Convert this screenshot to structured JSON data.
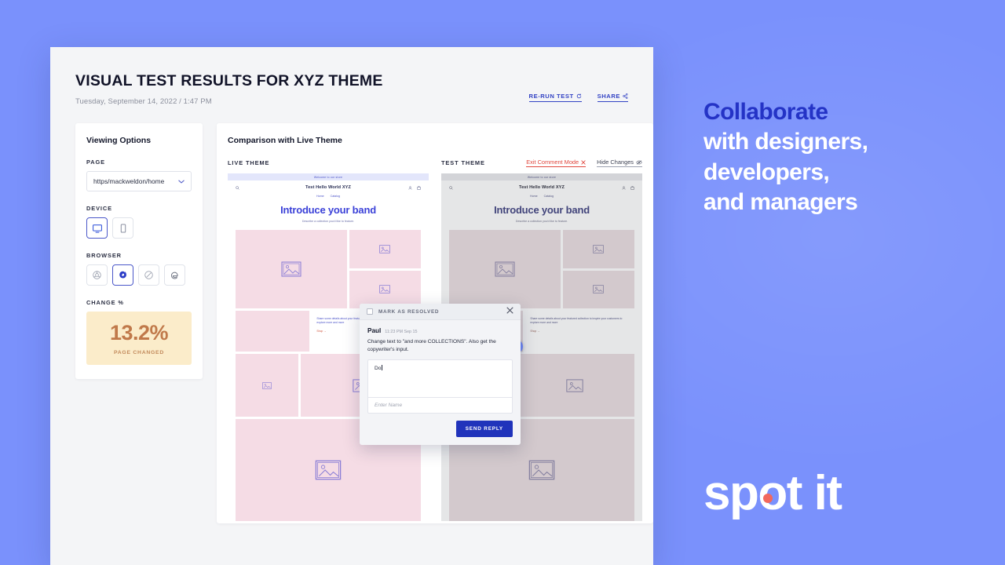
{
  "brand": {
    "headline_1": "Collaborate",
    "headline_2": "with designers,",
    "headline_3": "developers,",
    "headline_4": "and managers",
    "logo_text": "spot it",
    "accent_blue": "#7a91fc",
    "accent_navy": "#2433c6",
    "accent_coral": "#f2685e"
  },
  "app": {
    "title": "VISUAL TEST RESULTS FOR XYZ THEME",
    "date": "Tuesday, September 14, 2022 / 1:47 PM",
    "actions": [
      {
        "label": "RE-RUN TEST",
        "icon": "refresh-icon"
      },
      {
        "label": "SHARE",
        "icon": "share-icon"
      }
    ]
  },
  "sidebar": {
    "title": "Viewing Options",
    "page": {
      "label": "PAGE",
      "value": "https/mackweldon/home"
    },
    "device": {
      "label": "DEVICE",
      "options": [
        {
          "name": "desktop",
          "icon": "monitor-icon",
          "selected": true
        },
        {
          "name": "mobile",
          "icon": "phone-icon",
          "selected": false
        }
      ]
    },
    "browser": {
      "label": "BROWSER",
      "options": [
        {
          "name": "chrome",
          "icon": "chrome-icon",
          "selected": false
        },
        {
          "name": "firefox",
          "icon": "firefox-icon",
          "selected": true
        },
        {
          "name": "safari",
          "icon": "safari-icon",
          "selected": false
        },
        {
          "name": "edge",
          "icon": "edge-icon",
          "selected": false
        }
      ]
    },
    "change": {
      "label": "CHANGE %",
      "value": "13.2%",
      "caption": "PAGE CHANGED",
      "bg": "#fbecca",
      "fg": "#c0794a"
    }
  },
  "comparison": {
    "title": "Comparison with Live Theme",
    "live_label": "LIVE THEME",
    "test_label": "TEST THEME",
    "exit_comment_mode": "Exit Comment Mode",
    "hide_changes": "Hide Changes",
    "marker_count": "1"
  },
  "mock": {
    "announcement": "Welcome to our store",
    "brand": "Test Hello World XYZ",
    "nav": [
      "Home",
      "Catalog"
    ],
    "heading": "Introduce your band",
    "subheading": "Describe a collection you'd like to feature.",
    "text_block": "Share some details about your featured collection to inspire your customers to explore more and more",
    "shop_link": "Shop  →"
  },
  "popup": {
    "resolve_label": "MARK AS RESOLVED",
    "close_icon": "close-icon",
    "author": "Paul",
    "time": "11:23 PM Sep 15",
    "comment": "Change text to \"and more COLLECTIONS\". Also get the copywriter's input.",
    "reply_value": "Do",
    "name_placeholder": "Enter Name",
    "send_label": "SEND REPLY"
  }
}
